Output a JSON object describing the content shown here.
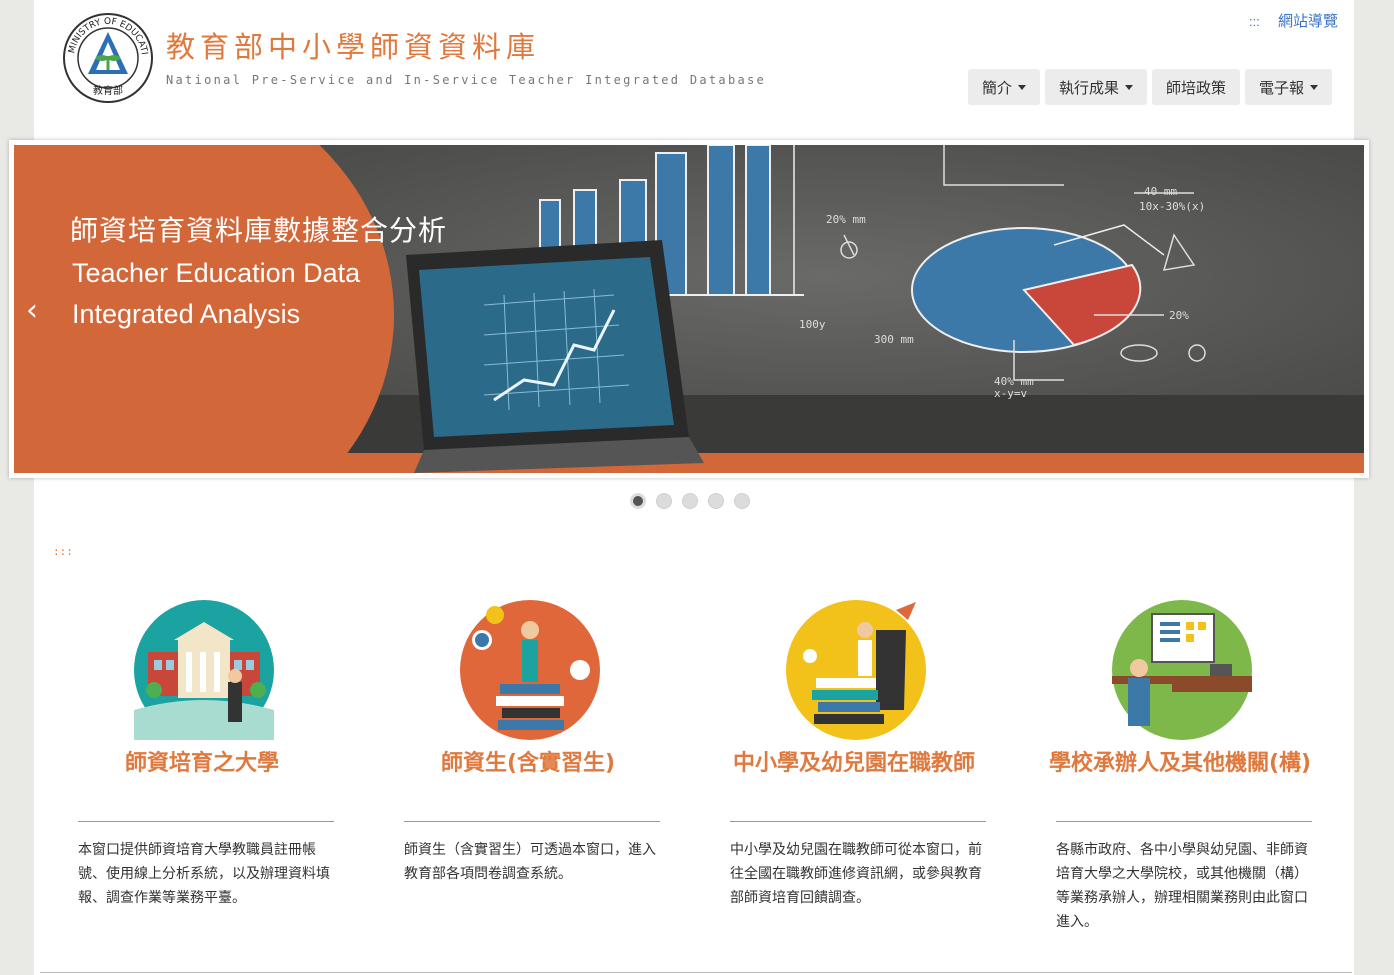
{
  "header": {
    "logo_text": "MINISTRY OF EDUCATION 教育部",
    "title": "教育部中小學師資資料庫",
    "subtitle": "National Pre-Service and In-Service Teacher Integrated Database",
    "sitemap_marker": ":::",
    "sitemap_label": "網站導覽"
  },
  "nav": [
    {
      "label": "簡介",
      "dropdown": true
    },
    {
      "label": "執行成果",
      "dropdown": true
    },
    {
      "label": "師培政策",
      "dropdown": false
    },
    {
      "label": "電子報",
      "dropdown": true
    }
  ],
  "banner": {
    "title_zh": "師資培育資料庫數據整合分析",
    "title_en_line1": "Teacher Education Data",
    "title_en_line2": "Integrated Analysis",
    "prev_label": "‹",
    "slide_count": 5,
    "active_slide": 1,
    "colors": {
      "accent": "#d2673a",
      "board": "#4f4f4d"
    }
  },
  "accesskey": ":::",
  "cards": [
    {
      "icon": "university-building-icon",
      "title": "師資培育之大學",
      "description": "本窗口提供師資培育大學教職員註冊帳號、使用線上分析系統，以及辦理資料填報、調查作業等業務平臺。",
      "color": "#1aa3a1"
    },
    {
      "icon": "student-books-icon",
      "title": "師資生(含實習生)",
      "description": "師資生（含實習生）可透過本窗口，進入教育部各項問卷調查系統。",
      "color": "#e0673a"
    },
    {
      "icon": "teacher-books-rocket-icon",
      "title": "中小學及幼兒園在職教師",
      "description": "中小學及幼兒園在職教師可從本窗口，前往全國在職教師進修資訊網，或參與教育部師資培育回饋調查。",
      "color": "#f2c21a"
    },
    {
      "icon": "classroom-presenter-icon",
      "title": "學校承辦人及其他機關(構)",
      "description": "各縣市政府、各中小學與幼兒園、非師資培育大學之大學院校，或其他機關（構）等業務承辦人，辦理相關業務則由此窗口進入。",
      "color": "#7fb84a"
    }
  ]
}
